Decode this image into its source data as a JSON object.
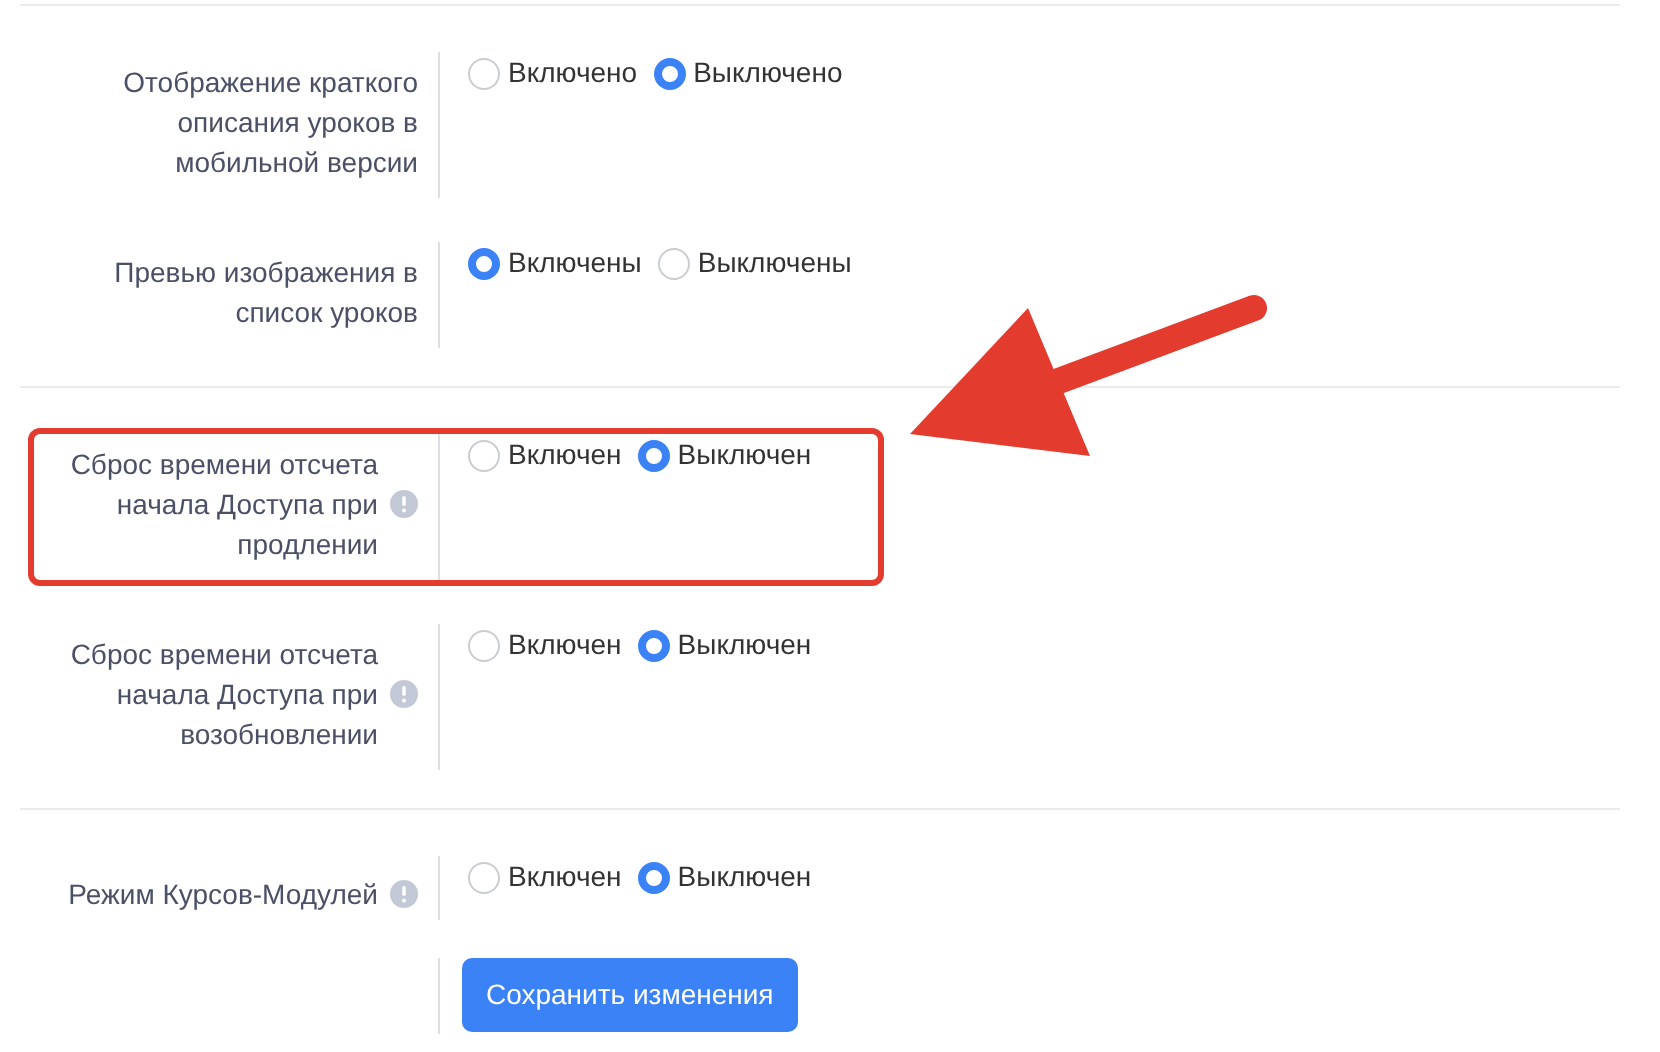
{
  "sections": [
    {
      "rows": [
        {
          "label": "Отображение краткого описания уроков в мобильной версии",
          "info": false,
          "highlighted": false,
          "options": [
            {
              "label": "Включено",
              "selected": false
            },
            {
              "label": "Выключено",
              "selected": true
            }
          ]
        },
        {
          "label": "Превью изображения в список уроков",
          "info": false,
          "highlighted": false,
          "options": [
            {
              "label": "Включены",
              "selected": true
            },
            {
              "label": "Выключены",
              "selected": false
            }
          ]
        }
      ]
    },
    {
      "rows": [
        {
          "label": "Сброс времени отсчета начала Доступа при продлении",
          "info": true,
          "highlighted": true,
          "options": [
            {
              "label": "Включен",
              "selected": false
            },
            {
              "label": "Выключен",
              "selected": true
            }
          ]
        },
        {
          "label": "Сброс времени отсчета начала Доступа при возобновлении",
          "info": true,
          "highlighted": false,
          "options": [
            {
              "label": "Включен",
              "selected": false
            },
            {
              "label": "Выключен",
              "selected": true
            }
          ]
        }
      ]
    },
    {
      "rows": [
        {
          "label": "Режим Курсов-Модулей",
          "info": true,
          "highlighted": false,
          "options": [
            {
              "label": "Включен",
              "selected": false
            },
            {
              "label": "Выключен",
              "selected": true
            }
          ]
        }
      ]
    }
  ],
  "save_button": "Сохранить изменения",
  "annotation_arrow": true
}
